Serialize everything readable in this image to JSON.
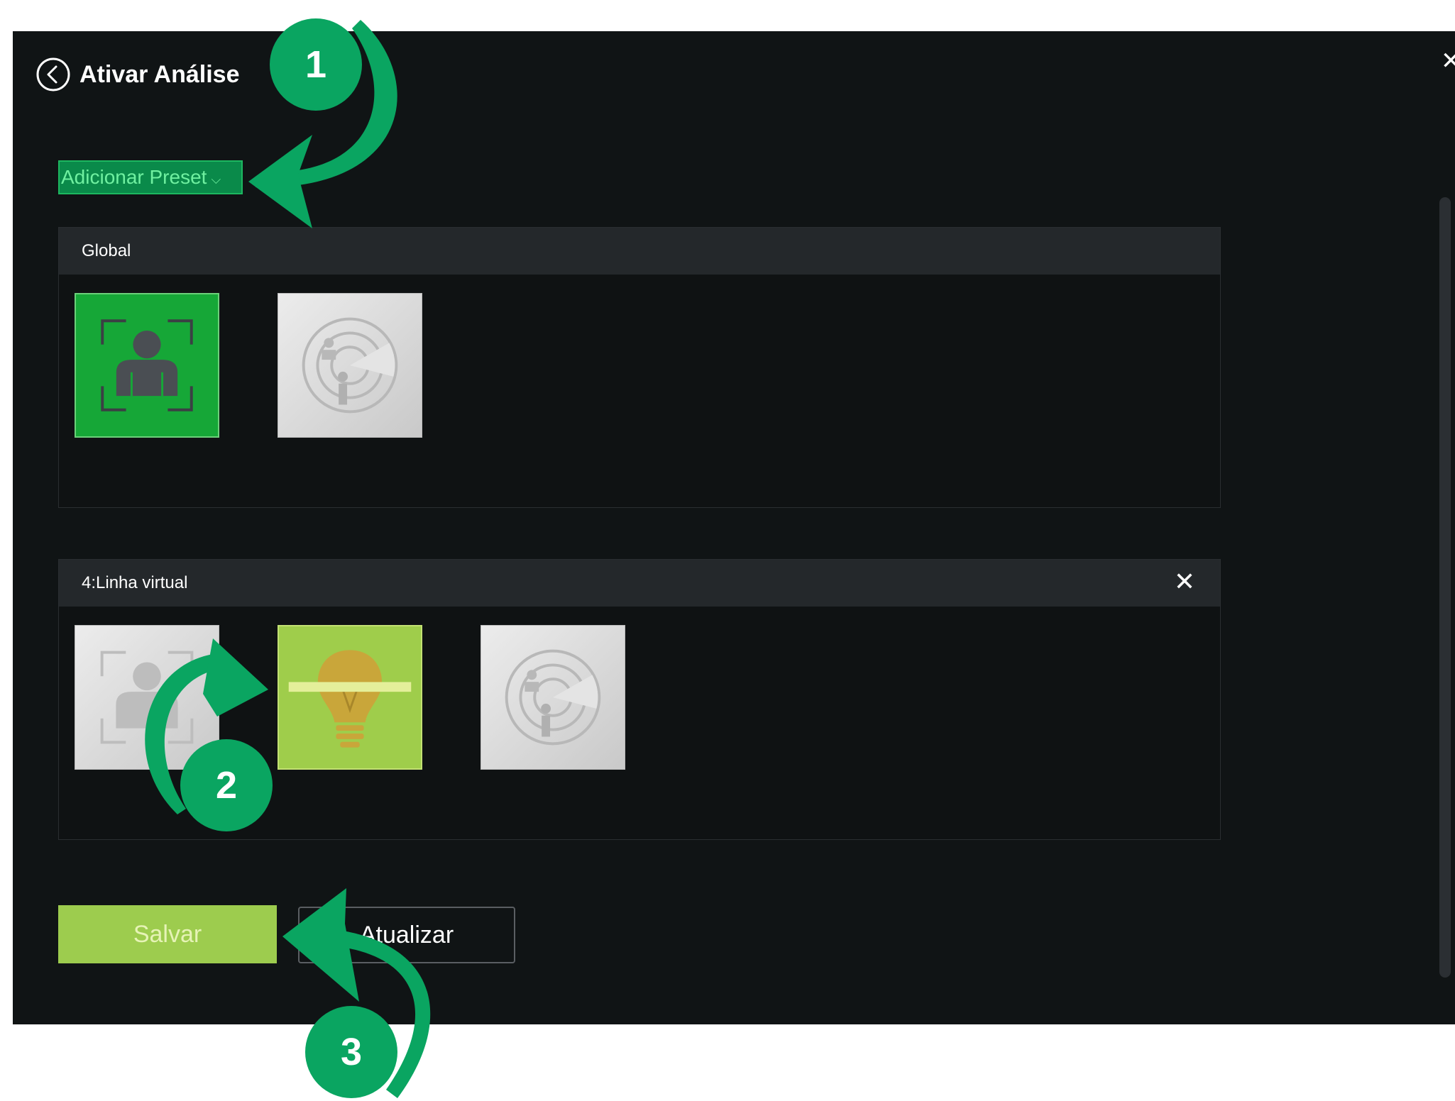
{
  "dialog": {
    "title": "Ativar Análise",
    "close_glyph": "✕",
    "back_icon": "chevron-left-circle-icon"
  },
  "preset": {
    "label": "Adicionar Preset",
    "chevron": "⌵"
  },
  "sections": [
    {
      "title": "Global",
      "closable": false,
      "tiles": [
        {
          "icon": "face-detection-icon",
          "state": "active"
        },
        {
          "icon": "radar-detection-icon",
          "state": "inactive"
        }
      ]
    },
    {
      "title": "4:Linha virtual",
      "closable": true,
      "close_glyph": "✕",
      "tiles": [
        {
          "icon": "face-detection-icon",
          "state": "inactive"
        },
        {
          "icon": "lightbulb-line-icon",
          "state": "active"
        },
        {
          "icon": "radar-detection-icon",
          "state": "inactive"
        }
      ]
    }
  ],
  "actions": {
    "save_label": "Salvar",
    "update_label": "Atualizar"
  },
  "steps": [
    "1",
    "2",
    "3"
  ],
  "colors": {
    "background": "#101415",
    "accent_green": "#16a737",
    "save_button": "#9dcc4e",
    "annotation": "#0aa561"
  }
}
